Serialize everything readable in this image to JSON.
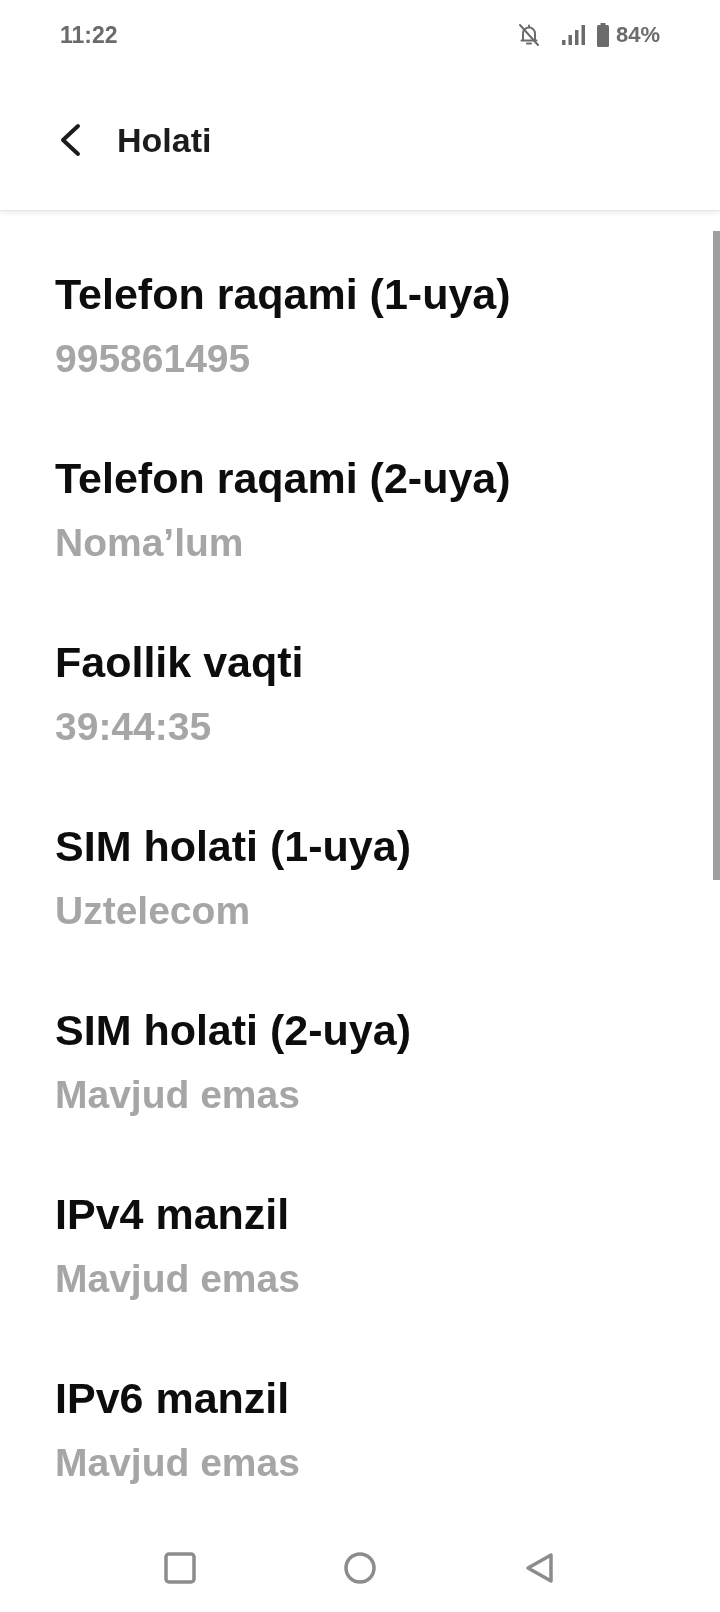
{
  "status_bar": {
    "time": "11:22",
    "battery": "84%"
  },
  "header": {
    "title": "Holati"
  },
  "items": [
    {
      "title": "Telefon raqami (1-uya)",
      "value": "995861495"
    },
    {
      "title": "Telefon raqami (2-uya)",
      "value": "Noma’lum"
    },
    {
      "title": "Faollik vaqti",
      "value": "39:44:35"
    },
    {
      "title": "SIM holati (1-uya)",
      "value": "Uztelecom"
    },
    {
      "title": "SIM holati (2-uya)",
      "value": "Mavjud emas"
    },
    {
      "title": "IPv4 manzil",
      "value": "Mavjud emas"
    },
    {
      "title": "IPv6 manzil",
      "value": "Mavjud emas"
    }
  ]
}
